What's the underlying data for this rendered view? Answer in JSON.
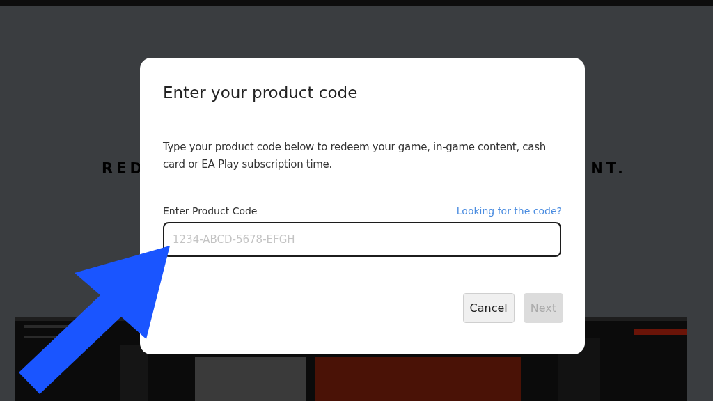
{
  "background": {
    "heading_parts": [
      "RED",
      "NT."
    ]
  },
  "dialog": {
    "title": "Enter your product code",
    "description": "Type your product code below to redeem your game, in-game content, cash card or EA Play subscription time.",
    "field": {
      "label": "Enter Product Code",
      "placeholder": "1234-ABCD-5678-EFGH"
    },
    "help_link": "Looking for the code?",
    "buttons": [
      {
        "label": "Cancel",
        "disabled": false
      },
      {
        "label": "Next",
        "disabled": true
      }
    ]
  }
}
